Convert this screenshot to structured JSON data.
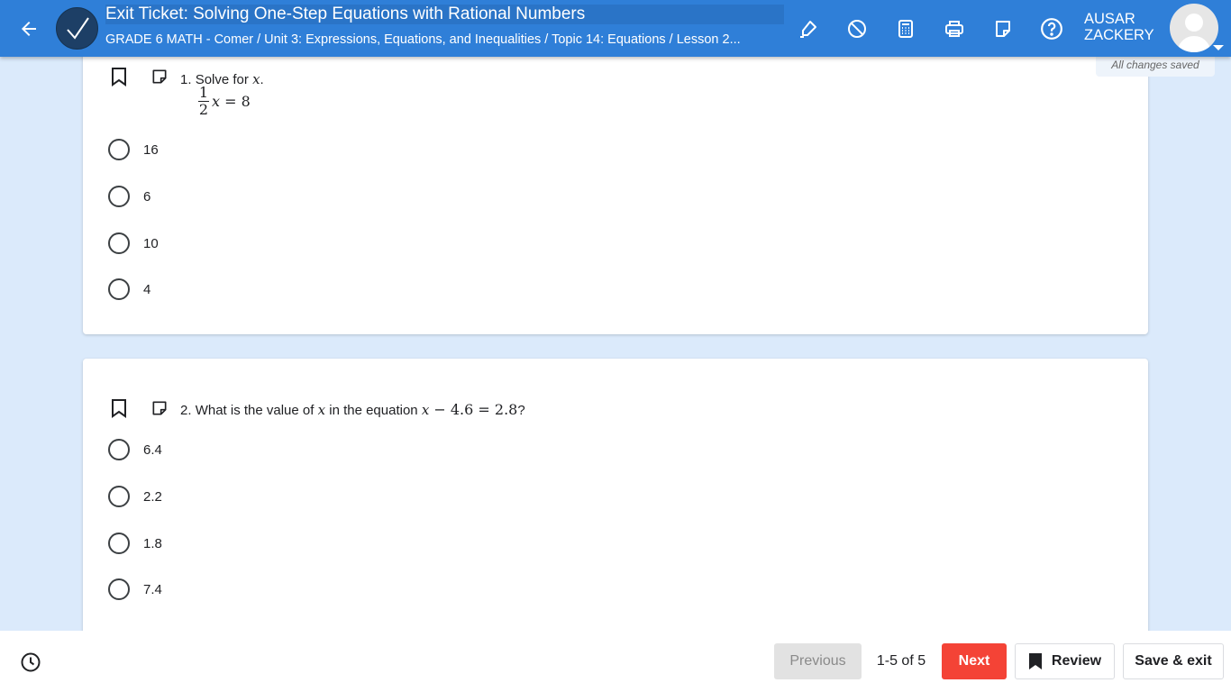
{
  "header": {
    "title": "Exit Ticket: Solving One-Step Equations with Rational Numbers",
    "breadcrumb": "GRADE 6 MATH - Comer / Unit 3: Expressions, Equations, and Inequalities / Topic 14: Equations / Lesson 2...",
    "user_first": "AUSAR",
    "user_last": "ZACKERY",
    "tools": [
      "highlighter-icon",
      "eliminator-icon",
      "calculator-icon",
      "print-icon",
      "sticky-note-icon",
      "help-icon"
    ]
  },
  "status": {
    "saved": "All changes saved"
  },
  "questions": [
    {
      "number": "1.",
      "prompt_pre": "Solve for ",
      "var": "x",
      "prompt_post": ".",
      "equation": {
        "numerator": "1",
        "denominator": "2",
        "var": "x",
        "rest": " = 8"
      },
      "options": [
        "16",
        "6",
        "10",
        "4"
      ]
    },
    {
      "number": "2.",
      "prompt_pre": "What is the value of ",
      "var": "x",
      "prompt_mid": " in the equation ",
      "eq_var": "x",
      "eq_rest": " − 4.6 = 2.8",
      "prompt_post": "?",
      "options": [
        "6.4",
        "2.2",
        "1.8",
        "7.4"
      ]
    }
  ],
  "footer": {
    "previous_label": "Previous",
    "page_count": "1-5 of 5",
    "next_label": "Next",
    "review_label": "Review",
    "save_exit_label": "Save & exit"
  },
  "colors": {
    "header_bg": "#2f7fd8",
    "page_bg": "#dbeafb",
    "next_button": "#f44336",
    "previous_disabled": "#e2e2e2"
  }
}
